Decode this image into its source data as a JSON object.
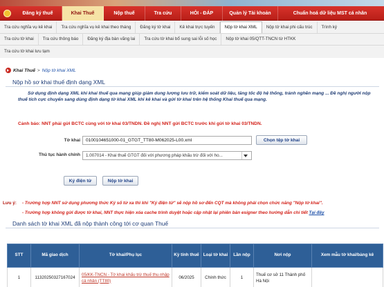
{
  "nav": {
    "items": [
      {
        "label": "Đăng ký thuế",
        "active": false
      },
      {
        "label": "Khai Thuế",
        "active": true
      },
      {
        "label": "Nộp thuế",
        "active": false
      },
      {
        "label": "Tra cứu",
        "active": false
      },
      {
        "label": "HỎI - ĐÁP",
        "active": false
      },
      {
        "label": "Quản lý Tài khoản",
        "active": false
      },
      {
        "label": "Chuẩn hoá dữ liệu MST cá nhân",
        "active": false
      }
    ]
  },
  "subnav": {
    "row1": [
      "Tra cứu nghĩa vụ kê khai",
      "Tra cứu nghĩa vụ kê khai theo tháng",
      "Đăng ký tờ khai",
      "Kê khai trực tuyến",
      "Nộp tờ khai XML",
      "Nộp tờ khai phi cấu trúc",
      "Trình ký"
    ],
    "row2": [
      "Tra cứu tờ khai",
      "Tra cứu thông báo",
      "Đăng ký địa bàn vãng lai",
      "Tra cứu tờ khai bổ sung sai lỗi số học",
      "Nộp tờ khai 05/QTT-TNCN từ HTKK"
    ],
    "row3": [
      "Tra cứu tờ khai lưu tạm"
    ],
    "active": "Nộp tờ khai XML"
  },
  "breadcrumb": {
    "root": "Khai Thuế",
    "separator": ">",
    "current": "Nộp tờ khai XML"
  },
  "form": {
    "title": "Nộp hồ sơ khai thuế định dạng XML",
    "intro": "Sử dụng định dạng XML khi khai thuế qua mạng giúp giảm dung lượng lưu trữ, kiểm soát dữ liệu, tăng tốc độ hệ thống, tránh nghẽn mạng ... Đề nghị người nộp thuế tích cực chuyển sang dùng định dạng tờ khai XML khi kê khai và gửi tờ khai trên hệ thống Khai thuế qua mạng.",
    "warning": "Cảnh báo: NNT phải gửi BCTC cùng với tờ khai 03/TNDN. Đề nghị NNT gửi BCTC trước khi gửi tờ khai 03/TNDN.",
    "file_label": "Tờ khai",
    "file_value": "0100104651000-01_GTGT_TT80-M062025-L00.xml",
    "choose_button": "Chọn tệp tờ khai",
    "procedure_label": "Thủ tục hành chính",
    "procedure_value": "1.007014 - Khai thuế GTGT đối với phương pháp khấu trừ đối với ho...",
    "sign_button": "Ký điện tử",
    "submit_button": "Nộp tờ khai"
  },
  "notes": {
    "label": "Lưu ý:",
    "line1": "- Trường hợp NNT sử dụng phương thức Ký số từ xa thì khi \"Ký điện tử\" sẽ nộp hồ sơ đến CQT mà không phải chọn chức năng \"Nộp tờ khai\".",
    "line2": "- Trường hợp không gửi được tờ khai, NNT thực hiện xóa cache trình duyệt hoặc cập nhật lại phiên bản esigner theo hướng dẫn chi tiết",
    "line2_link": "Tại đây"
  },
  "list": {
    "title": "Danh sách tờ khai XML đã nộp thành công tới cơ quan Thuế",
    "headers": [
      "STT",
      "Mã giao dịch",
      "Tờ khai/Phụ lục",
      "Kỳ tính thuế",
      "Loại tờ khai",
      "Lần nộp",
      "Nơi nộp",
      "Xem mẫu tờ khai/bảng kê"
    ],
    "rows": [
      {
        "stt": "1",
        "code": "11320250327167024",
        "form": "05/KK-TNCN - Tờ khai khấu trừ thuế thu nhập cá nhân (TT80)",
        "period": "06/2025",
        "type": "Chính thức",
        "times": "1",
        "place": "Thuế cơ sở 11 Thành phố Hà Nội",
        "view": ""
      }
    ]
  },
  "colors": {
    "nav_red": "#c9241d",
    "nav_active": "#f6e3a6",
    "title_blue": "#1e3d78",
    "warning_red": "#d21f17",
    "table_header": "#2e5f97"
  }
}
